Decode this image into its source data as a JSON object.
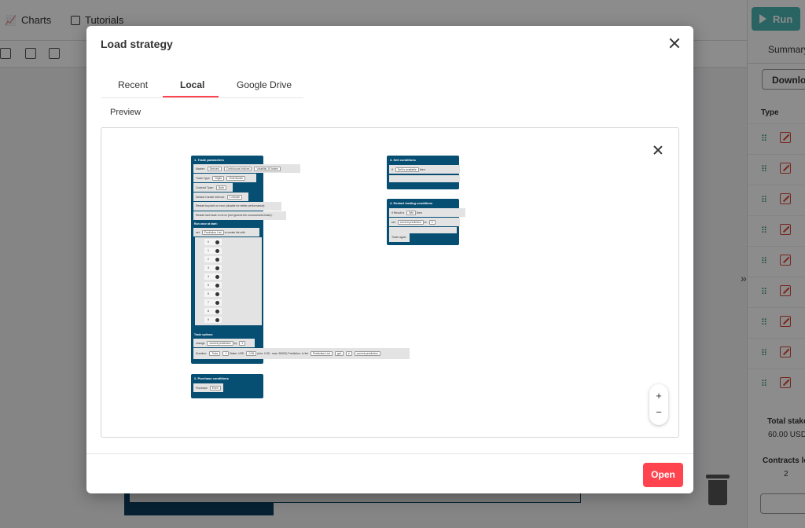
{
  "background": {
    "nav": {
      "charts_label": "Charts",
      "tutorials_label": "Tutorials"
    },
    "run_button_label": "Run",
    "summary_tab_label": "Summary",
    "download_button_label": "Download",
    "type_header": "Type",
    "total_stake_label": "Total stake",
    "total_stake_value": "60.00 USD",
    "contracts_lost_label": "Contracts lost",
    "contracts_lost_value": "2",
    "collapse_chevron": "»"
  },
  "modal": {
    "title": "Load strategy",
    "tabs": [
      {
        "label": "Recent"
      },
      {
        "label": "Local",
        "active": true
      },
      {
        "label": "Google Drive"
      }
    ],
    "preview_label": "Preview",
    "open_button_label": "Open",
    "accent_color": "#ff444f",
    "zoom_in_label": "+",
    "zoom_out_label": "−"
  },
  "preview_blocks": {
    "trade_parameters": {
      "title": "1. Trade parameters",
      "market_label": "Market:",
      "market_values": [
        "Derived",
        "Continuous Indices",
        "Volatility 10 Index"
      ],
      "trade_type_label": "Trade Type:",
      "trade_type_values": [
        "Digits",
        "Over/Under"
      ],
      "contract_type_label": "Contract Type:",
      "contract_type_value": "Both",
      "default_candle_label": "Default Candle Interval:",
      "default_candle_value": "1 minute",
      "restart_buy_sell": "Restart buy/sell on error (disable for better performance):",
      "restart_last_trade": "Restart last trade on error (bot ignores the unsuccessful trade):"
    },
    "run_once": {
      "title": "Run once at start:",
      "list_label": "set",
      "list_var": "Prediction List",
      "list_action": "to create list with",
      "numbers": [
        "0",
        "1",
        "2",
        "3",
        "4",
        "5",
        "6",
        "7",
        "8",
        "9"
      ]
    },
    "trade_options": {
      "title": "Trade options:",
      "change_label": "change",
      "change_var": "current prediction",
      "by_label": "by",
      "by_value": "1",
      "duration_label": "Duration:",
      "duration_unit": "Ticks",
      "duration_value": "1",
      "stake_label": "Stake: USD",
      "stake_value": "0.35",
      "stake_range": "(min: 0.35 - max: 50000)",
      "prediction_label": "Prediction:",
      "in_list": "in list",
      "list_var": "Prediction List",
      "get_label": "get",
      "hash_label": "#",
      "pred_var": "current prediction"
    },
    "purchase_conditions": {
      "title": "2. Purchase conditions",
      "purchase_label": "Purchase",
      "purchase_value": "Even"
    },
    "sell_conditions": {
      "title": "3. Sell conditions",
      "if_label": "if",
      "sell_available": "Sell is available",
      "then_label": "then"
    },
    "restart_conditions": {
      "title": "4. Restart trading conditions",
      "if_label": "if",
      "result_is": "Result is",
      "result_value": "Win",
      "then_label": "then",
      "set_label": "set",
      "current_pred": "current prediction",
      "to_label": "to",
      "to_value": "0",
      "trade_again": "Trade again"
    }
  }
}
